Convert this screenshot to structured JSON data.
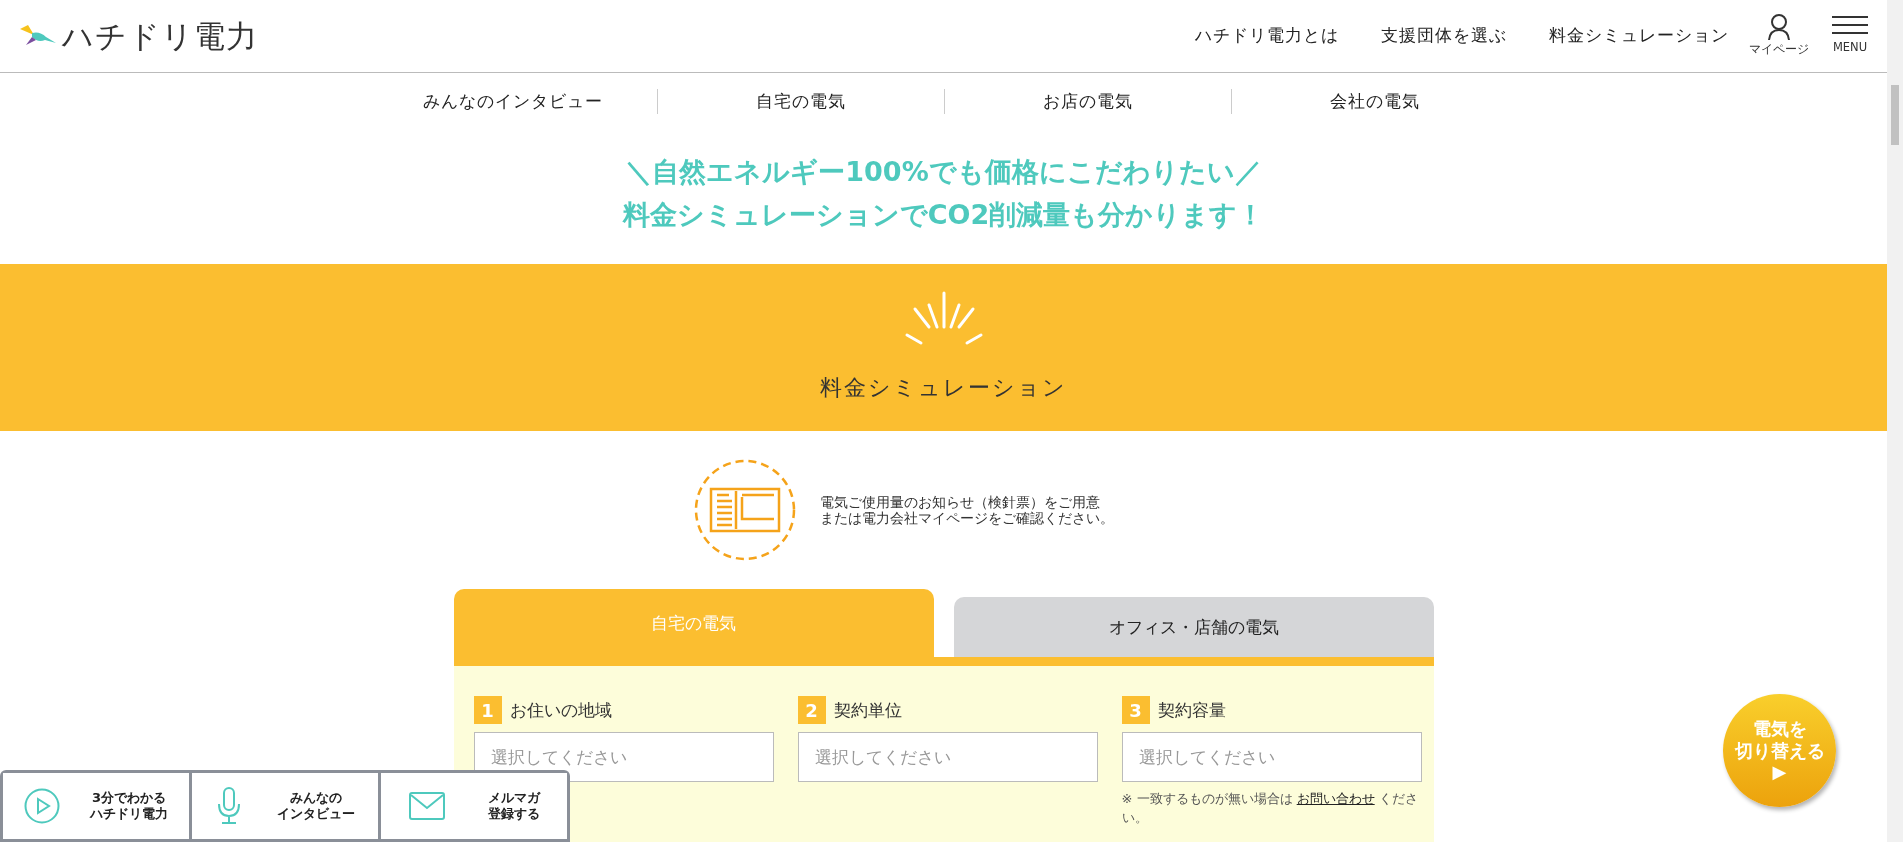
{
  "header": {
    "logo": "ハチドリ電力",
    "nav": [
      "ハチドリ電力とは",
      "支援団体を選ぶ",
      "料金シミュレーション"
    ],
    "mypage": "マイページ",
    "menu": "MENU"
  },
  "subnav": [
    "みんなのインタビュー",
    "自宅の電気",
    "お店の電気",
    "会社の電気"
  ],
  "tagline": [
    "＼自然エネルギー100%でも価格にこだわりたい／",
    "料金シミュレーションでCO2削減量も分かります！"
  ],
  "banner": {
    "title": "料金シミュレーション"
  },
  "notice": [
    "電気ご使用量のお知らせ（検針票）をご用意",
    "または電力会社マイページをご確認ください。"
  ],
  "tabs": [
    {
      "label": "自宅の電気",
      "selected": true
    },
    {
      "label": "オフィス・店舗の電気",
      "selected": false
    }
  ],
  "fields": [
    {
      "number": "1",
      "label": "お住いの地域",
      "placeholder": "選択してください"
    },
    {
      "number": "2",
      "label": "契約単位",
      "placeholder": "選択してください"
    },
    {
      "number": "3",
      "label": "契約容量",
      "placeholder": "選択してください"
    }
  ],
  "field_note": {
    "before": "※ 一致するものが無い場合は",
    "link": "お問い合わせ",
    "after": "ください。"
  },
  "bottom_bar": [
    {
      "kind": "play",
      "lines": [
        "3分でわかる",
        "ハチドリ電力"
      ]
    },
    {
      "kind": "mic",
      "lines": [
        "みんなの",
        "インタビュー"
      ]
    },
    {
      "kind": "mail",
      "lines": [
        "メルマガ",
        "登録する"
      ]
    }
  ],
  "switch_button": {
    "lines": [
      "電気を",
      "切り替える"
    ],
    "arrow": "▶"
  }
}
